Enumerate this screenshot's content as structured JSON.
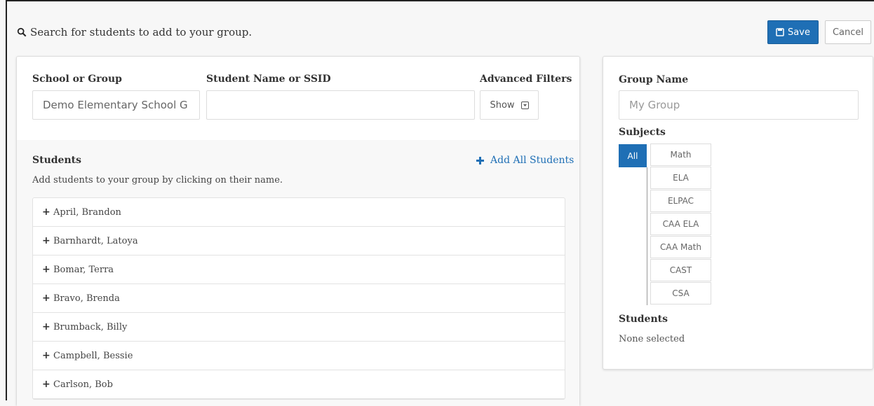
{
  "header": {
    "search_prompt": "Search for students to add to your group.",
    "save_label": "Save",
    "cancel_label": "Cancel"
  },
  "filters": {
    "school_label": "School or Group",
    "school_value": "Demo Elementary School G",
    "student_label": "Student Name or SSID",
    "student_value": "",
    "advanced_label": "Advanced Filters",
    "show_label": "Show"
  },
  "students_panel": {
    "heading": "Students",
    "help": "Add students to your group by clicking on their name.",
    "add_all_label": "Add All Students",
    "students": [
      "April, Brandon",
      "Barnhardt, Latoya",
      "Bomar, Terra",
      "Bravo, Brenda",
      "Brumback, Billy",
      "Campbell, Bessie",
      "Carlson, Bob"
    ]
  },
  "group_panel": {
    "group_name_label": "Group Name",
    "group_name_placeholder": "My Group",
    "subjects_label": "Subjects",
    "all_label": "All",
    "subjects": [
      "Math",
      "ELA",
      "ELPAC",
      "CAA ELA",
      "CAA Math",
      "CAST",
      "CSA"
    ],
    "students_label": "Students",
    "none_selected": "None selected"
  },
  "colors": {
    "accent": "#1f6fb5",
    "border": "#dddddd"
  },
  "icons": {
    "search": "search-icon",
    "save": "save-icon",
    "plus": "plus-icon",
    "caret": "caret-square-icon"
  }
}
